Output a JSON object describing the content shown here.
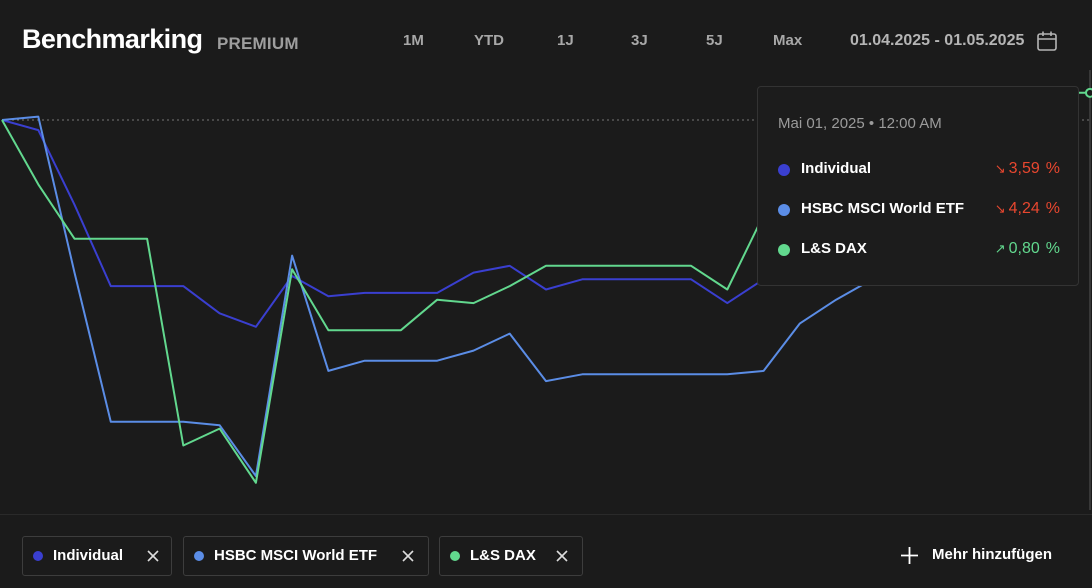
{
  "header": {
    "title": "Benchmarking",
    "badge": "PREMIUM",
    "ranges": [
      "1M",
      "YTD",
      "1J",
      "3J",
      "5J",
      "Max"
    ],
    "date_range": "01.04.2025 - 01.05.2025",
    "calendar_icon": "calendar-icon"
  },
  "colors": {
    "background": "#1b1b1b",
    "individual": "#3a3fd0",
    "hsbc": "#5b8de6",
    "dax": "#62d88e",
    "negative": "#e8472f",
    "positive": "#62d88e"
  },
  "tooltip": {
    "date": "Mai 01, 2025 • 12:00 AM",
    "rows": [
      {
        "name": "Individual",
        "arrow": "↘",
        "value": "3,59",
        "unit": "%",
        "trend": "negative"
      },
      {
        "name": "HSBC MSCI World ETF",
        "arrow": "↘",
        "value": "4,24",
        "unit": "%",
        "trend": "negative"
      },
      {
        "name": "L&S DAX",
        "arrow": "↗",
        "value": "0,80",
        "unit": "%",
        "trend": "positive"
      }
    ]
  },
  "chips": [
    {
      "label": "Individual",
      "close_icon": "close-icon"
    },
    {
      "label": "HSBC MSCI World ETF",
      "close_icon": "close-icon"
    },
    {
      "label": "L&S DAX",
      "close_icon": "close-icon"
    }
  ],
  "add_more": {
    "label": "Mehr hinzufügen",
    "icon": "plus-icon"
  },
  "chart_data": {
    "type": "line",
    "x": [
      0,
      1,
      2,
      3,
      4,
      5,
      6,
      7,
      8,
      9,
      10,
      11,
      12,
      13,
      14,
      15,
      16,
      17,
      18,
      19,
      20,
      21,
      22,
      23,
      24,
      25,
      26,
      27,
      28,
      29,
      30
    ],
    "series": [
      {
        "name": "Individual",
        "values": [
          0,
          -0.3,
          -2.5,
          -4.9,
          -4.9,
          -4.9,
          -5.7,
          -6.1,
          -4.6,
          -5.2,
          -5.1,
          -5.1,
          -5.1,
          -4.5,
          -4.3,
          -5.0,
          -4.7,
          -4.7,
          -4.7,
          -4.7,
          -5.4,
          -4.7,
          -4.2,
          -3.9,
          -3.6,
          -3.59,
          null,
          null,
          null,
          null,
          null
        ]
      },
      {
        "name": "HSBC MSCI World ETF",
        "values": [
          0,
          0.1,
          -4.5,
          -8.9,
          -8.9,
          -8.9,
          -9.0,
          -10.5,
          -4.0,
          -7.4,
          -7.1,
          -7.1,
          -7.1,
          -6.8,
          -6.3,
          -7.7,
          -7.5,
          -7.5,
          -7.5,
          -7.5,
          -7.5,
          -7.4,
          -6.0,
          -5.3,
          -4.7,
          -4.3,
          -4.24,
          null,
          null,
          null,
          null
        ]
      },
      {
        "name": "L&S DAX",
        "values": [
          0,
          -1.9,
          -3.5,
          -3.5,
          -3.5,
          -9.6,
          -9.1,
          -10.7,
          -4.4,
          -6.2,
          -6.2,
          -6.2,
          -5.3,
          -5.4,
          -4.9,
          -4.3,
          -4.3,
          -4.3,
          -4.3,
          -4.3,
          -5.0,
          -2.8,
          -1.9,
          -1.3,
          -0.8,
          -0.1,
          0.3,
          0.5,
          0.7,
          0.8,
          0.8
        ]
      }
    ],
    "ylim": [
      -11,
      0.5
    ]
  }
}
